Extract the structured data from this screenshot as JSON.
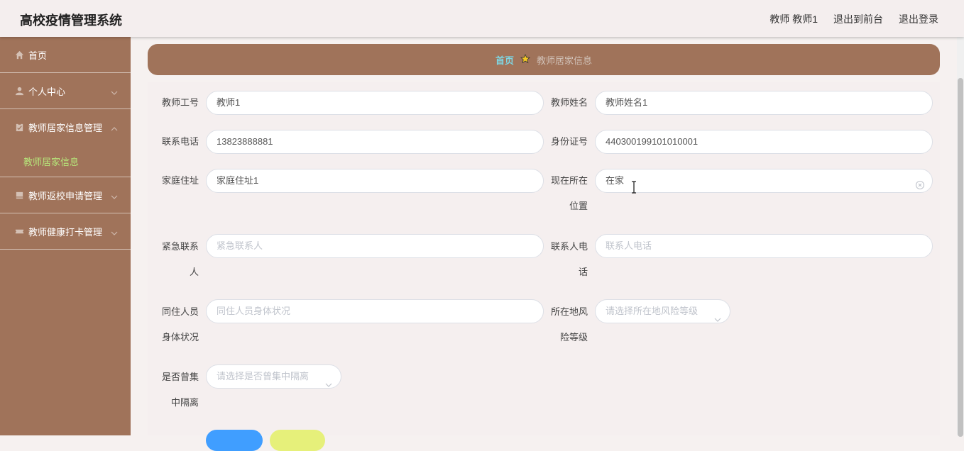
{
  "header": {
    "title": "高校疫情管理系统",
    "user": "教师 教师1",
    "back_to_front": "退出到前台",
    "logout": "退出登录"
  },
  "sidebar": {
    "items": [
      {
        "label": "首页",
        "icon": "home-icon"
      },
      {
        "label": "个人中心",
        "icon": "user-icon"
      },
      {
        "label": "教师居家信息管理",
        "icon": "clipboard-icon",
        "expanded": true,
        "children": [
          {
            "label": "教师居家信息",
            "active": true
          }
        ]
      },
      {
        "label": "教师返校申请管理",
        "icon": "book-icon"
      },
      {
        "label": "教师健康打卡管理",
        "icon": "ticket-icon"
      }
    ]
  },
  "breadcrumb": {
    "home": "首页",
    "current": "教师居家信息"
  },
  "form": {
    "teacher_id": {
      "label": "教师工号",
      "value": "教师1"
    },
    "teacher_name": {
      "label": "教师姓名",
      "value": "教师姓名1"
    },
    "phone": {
      "label": "联系电话",
      "value": "13823888881"
    },
    "id_number": {
      "label": "身份证号",
      "value": "440300199101010001"
    },
    "address": {
      "label": "家庭住址",
      "value": "家庭住址1"
    },
    "location": {
      "label_1": "现在所在",
      "label_2": "位置",
      "value": "在家"
    },
    "emergency_contact": {
      "label_1": "紧急联系",
      "label_2": "人",
      "placeholder": "紧急联系人"
    },
    "contact_phone": {
      "label_1": "联系人电",
      "label_2": "话",
      "placeholder": "联系人电话"
    },
    "cohabitant_health": {
      "label_1": "同住人员",
      "label_2": "身体状况",
      "placeholder": "同住人员身体状况"
    },
    "risk_level": {
      "label_1": "所在地风",
      "label_2": "险等级",
      "placeholder": "请选择所在地风险等级"
    },
    "quarantine": {
      "label_1": "是否曾集",
      "label_2": "中隔离",
      "placeholder": "请选择是否曾集中隔离"
    }
  },
  "colors": {
    "sidebar": "#a0735a",
    "accent_text": "#b6e57a",
    "breadcrumb_home": "#7fd6e2",
    "submit": "#409eff",
    "reset": "#e6f07a"
  }
}
